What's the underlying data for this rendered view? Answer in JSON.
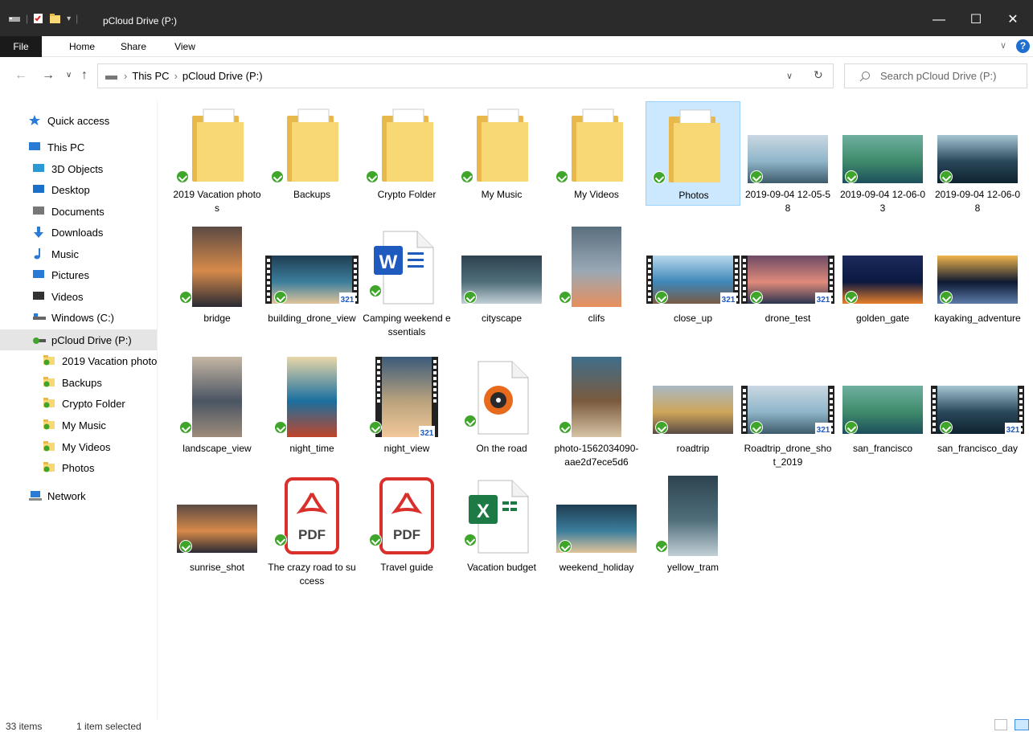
{
  "window": {
    "title": "pCloud Drive (P:)"
  },
  "ribbon": {
    "tabs": [
      "File",
      "Home",
      "Share",
      "View"
    ]
  },
  "address": {
    "crumbs": [
      "This PC",
      "pCloud Drive (P:)"
    ]
  },
  "search": {
    "placeholder": "Search pCloud Drive (P:)"
  },
  "sidebar": {
    "items": [
      {
        "label": "Quick access",
        "icon": "star-icon"
      },
      {
        "label": "This PC",
        "icon": "monitor-icon"
      },
      {
        "label": "3D Objects",
        "icon": "cube-icon"
      },
      {
        "label": "Desktop",
        "icon": "desktop-icon"
      },
      {
        "label": "Documents",
        "icon": "document-icon"
      },
      {
        "label": "Downloads",
        "icon": "download-arrow-icon"
      },
      {
        "label": "Music",
        "icon": "music-note-icon"
      },
      {
        "label": "Pictures",
        "icon": "pictures-icon"
      },
      {
        "label": "Videos",
        "icon": "film-icon"
      },
      {
        "label": "Windows (C:)",
        "icon": "drive-icon"
      },
      {
        "label": "pCloud Drive (P:)",
        "icon": "cloud-drive-icon"
      },
      {
        "label": "2019 Vacation photos",
        "icon": "folder-icon"
      },
      {
        "label": "Backups",
        "icon": "folder-icon"
      },
      {
        "label": "Crypto Folder",
        "icon": "folder-icon"
      },
      {
        "label": "My Music",
        "icon": "folder-icon"
      },
      {
        "label": "My Videos",
        "icon": "folder-icon"
      },
      {
        "label": "Photos",
        "icon": "folder-icon"
      },
      {
        "label": "Network",
        "icon": "network-icon"
      }
    ]
  },
  "items": [
    {
      "name": "2019 Vacation photos",
      "kind": "folder"
    },
    {
      "name": "Backups",
      "kind": "folder"
    },
    {
      "name": "Crypto Folder",
      "kind": "folder"
    },
    {
      "name": "My Music",
      "kind": "folder"
    },
    {
      "name": "My Videos",
      "kind": "folder"
    },
    {
      "name": "Photos",
      "kind": "folder"
    },
    {
      "name": "2019-09-04 12-05-58",
      "kind": "photo"
    },
    {
      "name": "2019-09-04 12-06-03",
      "kind": "photo"
    },
    {
      "name": "2019-09-04 12-06-08",
      "kind": "photo"
    },
    {
      "name": "bridge",
      "kind": "photo"
    },
    {
      "name": "building_drone_view",
      "kind": "video"
    },
    {
      "name": "Camping weekend essentials",
      "kind": "word"
    },
    {
      "name": "cityscape",
      "kind": "photo"
    },
    {
      "name": "clifs",
      "kind": "photo"
    },
    {
      "name": "close_up",
      "kind": "video"
    },
    {
      "name": "drone_test",
      "kind": "video"
    },
    {
      "name": "golden_gate",
      "kind": "photo"
    },
    {
      "name": "kayaking_adventure",
      "kind": "photo"
    },
    {
      "name": "landscape_view",
      "kind": "photo"
    },
    {
      "name": "night_time",
      "kind": "photo"
    },
    {
      "name": "night_view",
      "kind": "video"
    },
    {
      "name": "On the road",
      "kind": "audio"
    },
    {
      "name": "photo-1562034090-aae2d7ece5d6",
      "kind": "photo"
    },
    {
      "name": "roadtrip",
      "kind": "photo"
    },
    {
      "name": "Roadtrip_drone_shot_2019",
      "kind": "video"
    },
    {
      "name": "san_francisco",
      "kind": "photo"
    },
    {
      "name": "san_francisco_day",
      "kind": "video"
    },
    {
      "name": "sunrise_shot",
      "kind": "photo"
    },
    {
      "name": "The crazy road to success",
      "kind": "pdf"
    },
    {
      "name": "Travel guide",
      "kind": "pdf"
    },
    {
      "name": "Vacation budget",
      "kind": "excel"
    },
    {
      "name": "weekend_holiday",
      "kind": "photo"
    },
    {
      "name": "yellow_tram",
      "kind": "photo"
    }
  ],
  "status": {
    "count": "33 items",
    "selection": "1 item selected"
  },
  "colors": {
    "sync_check": "#3fa52b",
    "selection": "#cce8ff",
    "folder": "#f8d775"
  }
}
